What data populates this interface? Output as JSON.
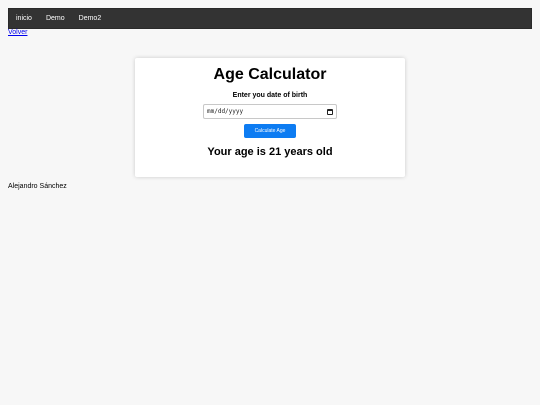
{
  "nav": {
    "items": [
      "inicio",
      "Demo",
      "Demo2"
    ]
  },
  "back_link": "Volver",
  "calculator": {
    "title": "Age Calculator",
    "dob_label": "Enter you date of birth",
    "date_placeholder": "mm/dd/yyyy",
    "button_label": "Calculate Age",
    "result_text": "Your age is 21 years old"
  },
  "footer": {
    "author": "Alejandro Sánchez"
  },
  "colors": {
    "navbar": "#333333",
    "button": "#0d7cf2",
    "background": "#f7f7f7"
  },
  "icons": {
    "date_picker": "calendar-icon"
  }
}
